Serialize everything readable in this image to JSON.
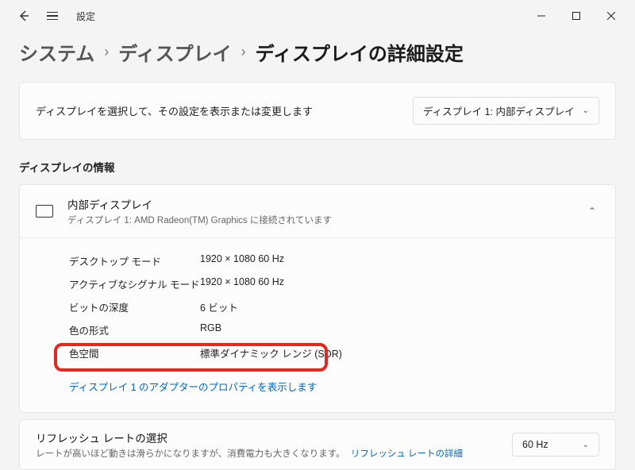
{
  "app_title": "設定",
  "breadcrumb": {
    "item1": "システム",
    "item2": "ディスプレイ",
    "current": "ディスプレイの詳細設定"
  },
  "select_card": {
    "text": "ディスプレイを選択して、その設定を表示または変更します",
    "dropdown_value": "ディスプレイ 1: 内部ディスプレイ"
  },
  "info_heading": "ディスプレイの情報",
  "expander": {
    "title": "内部ディスプレイ",
    "subtitle": "ディスプレイ 1: AMD Radeon(TM) Graphics に接続されています"
  },
  "props": {
    "r1l": "デスクトップ モード",
    "r1v": "1920 × 1080 60 Hz",
    "r2l": "アクティブなシグナル モード",
    "r2v": "1920 × 1080 60 Hz",
    "r3l": "ビットの深度",
    "r3v": "6 ビット",
    "r4l": "色の形式",
    "r4v": "RGB",
    "r5l": "色空間",
    "r5v": "標準ダイナミック レンジ (SDR)"
  },
  "adapter_link": "ディスプレイ 1 のアダプターのプロパティを表示します",
  "refresh": {
    "title": "リフレッシュ レートの選択",
    "sub": "レートが高いほど動きは滑らかになりますが、消費電力も大きくなります。",
    "link": "リフレッシュ レートの詳細",
    "value": "60 Hz"
  }
}
